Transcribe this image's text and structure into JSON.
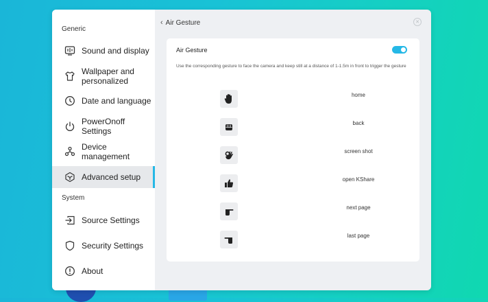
{
  "sidebar": {
    "generic_title": "Generic",
    "system_title": "System",
    "items": [
      {
        "label": "Sound and display",
        "icon": "sound-display-icon"
      },
      {
        "label": "Wallpaper and personalized",
        "icon": "shirt-icon"
      },
      {
        "label": "Date and language",
        "icon": "clock-icon"
      },
      {
        "label": "PowerOnoff Settings",
        "icon": "power-icon"
      },
      {
        "label": "Device management",
        "icon": "device-management-icon"
      },
      {
        "label": "Advanced setup",
        "icon": "cube-icon",
        "active": true
      },
      {
        "label": "Source Settings",
        "icon": "source-input-icon"
      },
      {
        "label": "Security Settings",
        "icon": "shield-icon"
      },
      {
        "label": "About",
        "icon": "info-icon"
      }
    ]
  },
  "header": {
    "back_glyph": "‹",
    "title": "Air Gesture",
    "close_glyph": "✕"
  },
  "card": {
    "title": "Air Gesture",
    "toggle_on": true,
    "description": "Use the corresponding gesture to face the camera and keep still at a distance of 1-1.5m in front to trigger the gesture"
  },
  "gestures": [
    {
      "label": "home",
      "icon": "open-palm-icon"
    },
    {
      "label": "back",
      "icon": "fist-icon"
    },
    {
      "label": "screen shot",
      "icon": "ok-hand-icon"
    },
    {
      "label": "open KShare",
      "icon": "thumbs-up-icon"
    },
    {
      "label": "next page",
      "icon": "point-right-icon"
    },
    {
      "label": "last page",
      "icon": "point-left-icon"
    }
  ],
  "colors": {
    "accent": "#25b8e6",
    "sidebar_active_bg": "#e6e8eb"
  }
}
